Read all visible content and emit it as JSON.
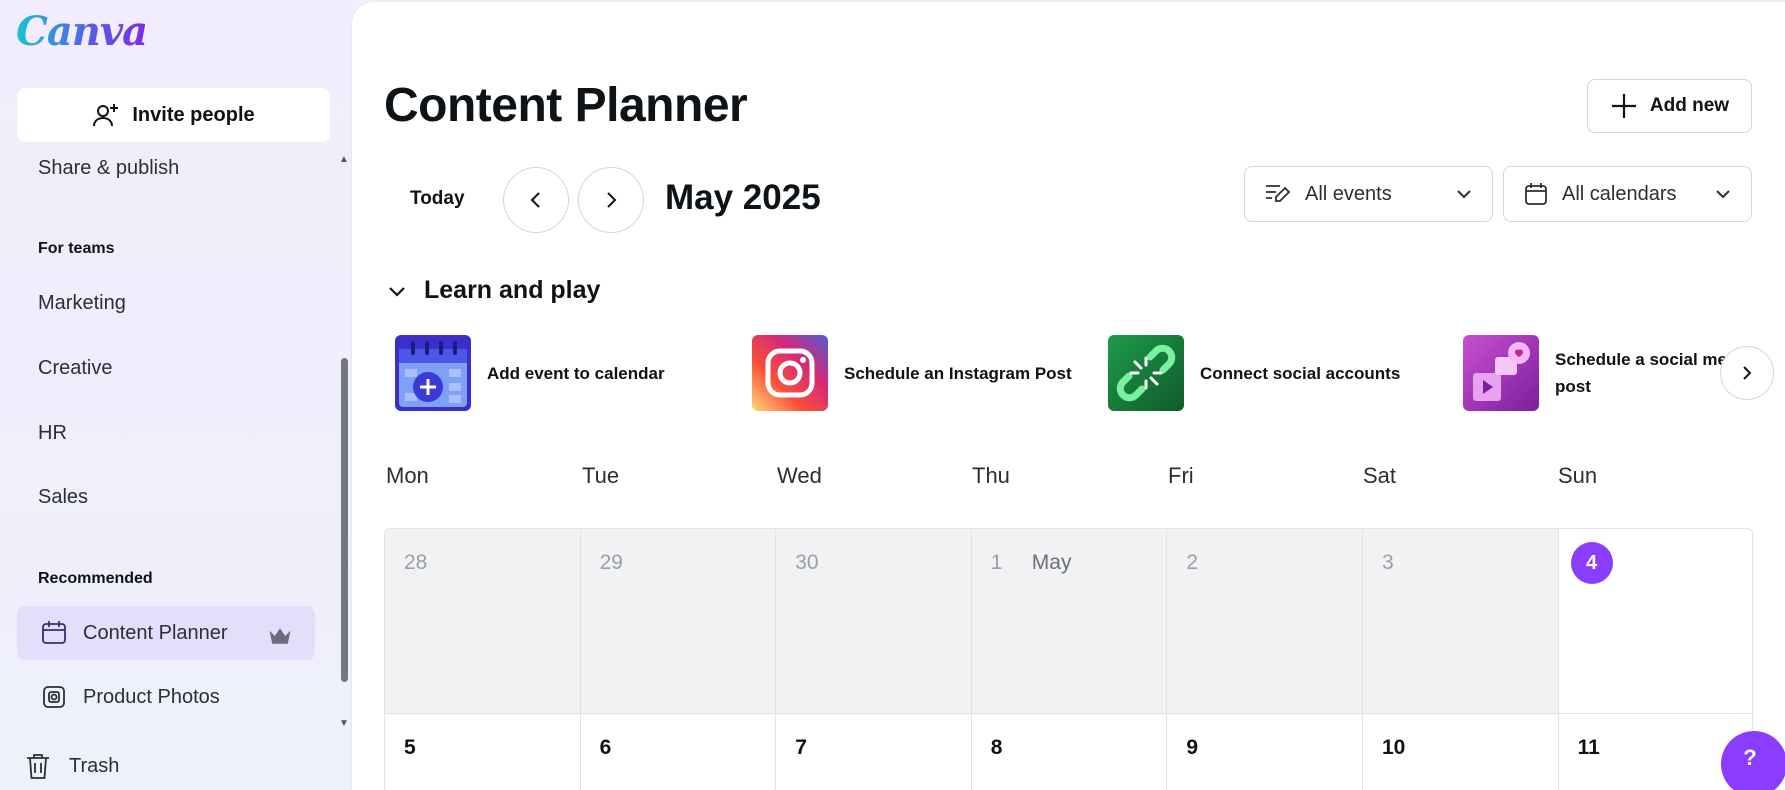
{
  "sidebar": {
    "logo": "Canva",
    "invite_label": "Invite people",
    "share_label": "Share & publish",
    "teams_heading": "For teams",
    "team_items": [
      "Marketing",
      "Creative",
      "HR",
      "Sales"
    ],
    "recommended_heading": "Recommended",
    "content_planner_label": "Content Planner",
    "product_photos_label": "Product Photos",
    "trash_label": "Trash"
  },
  "main": {
    "title": "Content Planner",
    "add_new_label": "Add new",
    "today_label": "Today",
    "month_label": "May 2025",
    "events_filter": "All events",
    "calendars_filter": "All calendars",
    "learn_heading": "Learn and play",
    "cards": [
      {
        "label": "Add event to calendar",
        "icon": "calendar-add-icon"
      },
      {
        "label": "Schedule an Instagram Post",
        "icon": "instagram-icon"
      },
      {
        "label": "Connect social accounts",
        "icon": "link-icon"
      },
      {
        "label": "Schedule a social me\npost",
        "icon": "social-media-icon"
      }
    ]
  },
  "calendar": {
    "weekdays": [
      "Mon",
      "Tue",
      "Wed",
      "Thu",
      "Fri",
      "Sat",
      "Sun"
    ],
    "week1": [
      "28",
      "29",
      "30",
      "1",
      "2",
      "3",
      "4"
    ],
    "week1_month_marker": "May",
    "week2": [
      "5",
      "6",
      "7",
      "8",
      "9",
      "10",
      "11"
    ]
  },
  "help_label": "?",
  "colors": {
    "accent": "#8b3dff",
    "active_bg": "#e4ddfb",
    "past_cell": "#f1f2f4"
  }
}
